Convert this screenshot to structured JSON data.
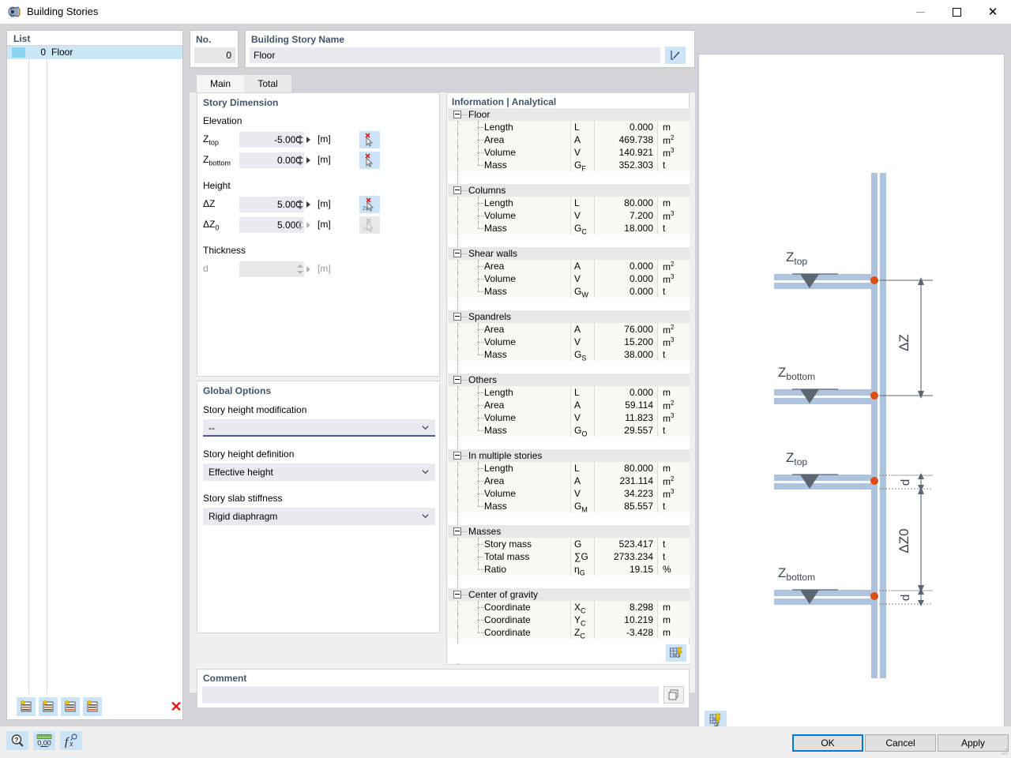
{
  "window": {
    "title": "Building Stories",
    "icon": "building-stories-icon",
    "minimize": "minimize-icon",
    "maximize": "maximize-icon",
    "close": "close-icon"
  },
  "list": {
    "header": "List",
    "rows": [
      {
        "no": "0",
        "name": "Floor"
      }
    ],
    "toolbar": [
      {
        "name": "insert-story-above-button",
        "icon": "row-insert-icon"
      },
      {
        "name": "insert-story-below-button",
        "icon": "row-insert-icon"
      },
      {
        "name": "add-story-top-button",
        "icon": "row-add-icon"
      },
      {
        "name": "add-story-bottom-button",
        "icon": "row-add-icon"
      }
    ],
    "delete_label": "✕"
  },
  "header": {
    "no_label": "No.",
    "no_value": "0",
    "name_label": "Building Story Name",
    "name_value": "Floor",
    "name_edit_icon": "edit-pencil-icon"
  },
  "tabs": [
    {
      "label": "Main",
      "selected": true
    },
    {
      "label": "Total",
      "selected": false
    }
  ],
  "story_dimension": {
    "title": "Story Dimension",
    "elevation_group": "Elevation",
    "height_group": "Height",
    "thickness_group": "Thickness",
    "fields": [
      {
        "label": "Z",
        "sub": "top",
        "value": "-5.000",
        "unit": "[m]",
        "enabled": true
      },
      {
        "label": "Z",
        "sub": "bottom",
        "value": "0.000",
        "unit": "[m]",
        "enabled": true
      },
      {
        "label": "ΔZ",
        "sub": "",
        "value": "5.000",
        "unit": "[m]",
        "enabled": true
      },
      {
        "label": "ΔZ",
        "sub": "0",
        "value": "5.000",
        "unit": "[m]",
        "enabled": true
      },
      {
        "label": "d",
        "sub": "",
        "value": "",
        "unit": "[m]",
        "enabled": false
      }
    ]
  },
  "global_options": {
    "title": "Global Options",
    "items": [
      {
        "label": "Story height modification",
        "value": "--",
        "focused": true
      },
      {
        "label": "Story height definition",
        "value": "Effective height",
        "focused": false
      },
      {
        "label": "Story slab stiffness",
        "value": "Rigid diaphragm",
        "focused": false
      }
    ]
  },
  "information": {
    "title": "Information | Analytical",
    "groups": [
      {
        "name": "Floor",
        "rows": [
          {
            "name": "Length",
            "symbol": "L",
            "sub": "",
            "value": "0.000",
            "unit": "m"
          },
          {
            "name": "Area",
            "symbol": "A",
            "sub": "",
            "value": "469.738",
            "unit": "m²"
          },
          {
            "name": "Volume",
            "symbol": "V",
            "sub": "",
            "value": "140.921",
            "unit": "m³"
          },
          {
            "name": "Mass",
            "symbol": "G",
            "sub": "F",
            "value": "352.303",
            "unit": "t"
          }
        ]
      },
      {
        "name": "Columns",
        "rows": [
          {
            "name": "Length",
            "symbol": "L",
            "sub": "",
            "value": "80.000",
            "unit": "m"
          },
          {
            "name": "Volume",
            "symbol": "V",
            "sub": "",
            "value": "7.200",
            "unit": "m³"
          },
          {
            "name": "Mass",
            "symbol": "G",
            "sub": "C",
            "value": "18.000",
            "unit": "t"
          }
        ]
      },
      {
        "name": "Shear walls",
        "rows": [
          {
            "name": "Area",
            "symbol": "A",
            "sub": "",
            "value": "0.000",
            "unit": "m²"
          },
          {
            "name": "Volume",
            "symbol": "V",
            "sub": "",
            "value": "0.000",
            "unit": "m³"
          },
          {
            "name": "Mass",
            "symbol": "G",
            "sub": "W",
            "value": "0.000",
            "unit": "t"
          }
        ]
      },
      {
        "name": "Spandrels",
        "rows": [
          {
            "name": "Area",
            "symbol": "A",
            "sub": "",
            "value": "76.000",
            "unit": "m²"
          },
          {
            "name": "Volume",
            "symbol": "V",
            "sub": "",
            "value": "15.200",
            "unit": "m³"
          },
          {
            "name": "Mass",
            "symbol": "G",
            "sub": "S",
            "value": "38.000",
            "unit": "t"
          }
        ]
      },
      {
        "name": "Others",
        "rows": [
          {
            "name": "Length",
            "symbol": "L",
            "sub": "",
            "value": "0.000",
            "unit": "m"
          },
          {
            "name": "Area",
            "symbol": "A",
            "sub": "",
            "value": "59.114",
            "unit": "m²"
          },
          {
            "name": "Volume",
            "symbol": "V",
            "sub": "",
            "value": "11.823",
            "unit": "m³"
          },
          {
            "name": "Mass",
            "symbol": "G",
            "sub": "O",
            "value": "29.557",
            "unit": "t"
          }
        ]
      },
      {
        "name": "In multiple stories",
        "rows": [
          {
            "name": "Length",
            "symbol": "L",
            "sub": "",
            "value": "80.000",
            "unit": "m"
          },
          {
            "name": "Area",
            "symbol": "A",
            "sub": "",
            "value": "231.114",
            "unit": "m²"
          },
          {
            "name": "Volume",
            "symbol": "V",
            "sub": "",
            "value": "34.223",
            "unit": "m³"
          },
          {
            "name": "Mass",
            "symbol": "G",
            "sub": "M",
            "value": "85.557",
            "unit": "t"
          }
        ]
      },
      {
        "name": "Masses",
        "rows": [
          {
            "name": "Story mass",
            "symbol": "G",
            "sub": "",
            "value": "523.417",
            "unit": "t"
          },
          {
            "name": "Total mass",
            "symbol": "∑G",
            "sub": "",
            "value": "2733.234",
            "unit": "t"
          },
          {
            "name": "Ratio",
            "symbol": "η",
            "sub": "G",
            "value": "19.15",
            "unit": "%"
          }
        ]
      },
      {
        "name": "Center of gravity",
        "rows": [
          {
            "name": "Coordinate",
            "symbol": "X",
            "sub": "C",
            "value": "8.298",
            "unit": "m"
          },
          {
            "name": "Coordinate",
            "symbol": "Y",
            "sub": "C",
            "value": "10.219",
            "unit": "m"
          },
          {
            "name": "Coordinate",
            "symbol": "Z",
            "sub": "C",
            "value": "-3.428",
            "unit": "m"
          }
        ]
      }
    ],
    "footer_button_icon": "table-export-icon"
  },
  "comment": {
    "label": "Comment",
    "value": "",
    "placeholder": "",
    "copy_icon": "copy-icon"
  },
  "graphic": {
    "button_icon": "graphic-settings-icon",
    "diagrams": [
      {
        "name": "delta-z-diagram",
        "labels": {
          "top": "Z",
          "top_sub": "top",
          "bottom": "Z",
          "bottom_sub": "bottom",
          "dimension": "ΔZ"
        }
      },
      {
        "name": "delta-z0-diagram",
        "labels": {
          "top": "Z",
          "top_sub": "top",
          "bottom": "Z",
          "bottom_sub": "bottom",
          "dimension": "ΔZ0",
          "thickness": "d"
        }
      }
    ],
    "colors": {
      "member": "#aec3de",
      "node": "#e04a14",
      "dim_line": "#5b6670"
    }
  },
  "statusbar": {
    "buttons": [
      {
        "name": "help-button",
        "icon": "question-magnifier-icon"
      },
      {
        "name": "units-button",
        "icon": "units-ruler-icon"
      },
      {
        "name": "functions-button",
        "icon": "fx-icon"
      }
    ],
    "ok": "OK",
    "cancel": "Cancel",
    "apply": "Apply"
  }
}
